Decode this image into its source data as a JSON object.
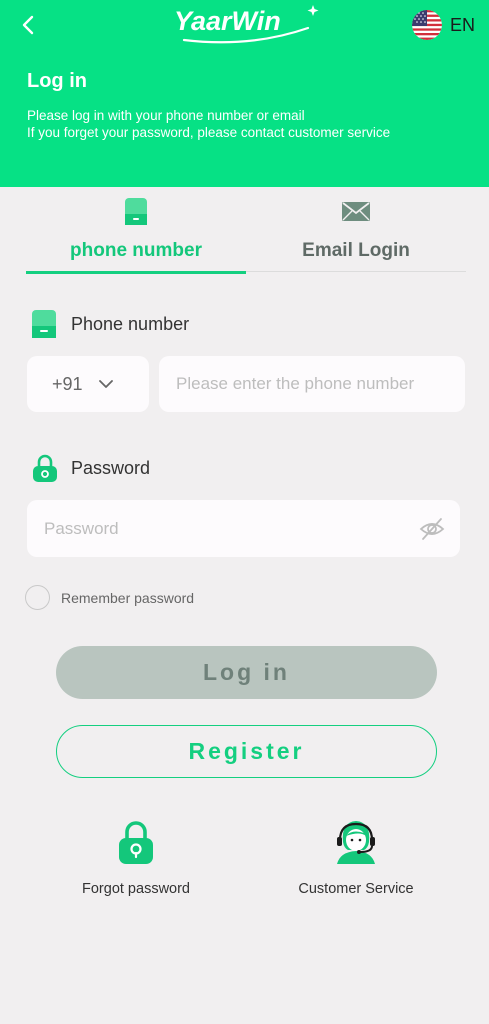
{
  "header": {
    "back_icon": "chevron-left-icon",
    "logo_text": "YaarWin",
    "language": "EN",
    "flag_icon": "us-flag-icon",
    "title": "Log in",
    "subtitle_line1": "Please log in with your phone number or email",
    "subtitle_line2": "If you forget your password, please contact customer service",
    "background_color": "#06e185"
  },
  "tabs": [
    {
      "label": "phone number",
      "icon": "phone-icon",
      "active": true
    },
    {
      "label": "Email Login",
      "icon": "envelope-icon",
      "active": false
    }
  ],
  "form": {
    "phone_label": "Phone number",
    "country_code": "+91",
    "phone_placeholder": "Please enter the phone number",
    "password_label": "Password",
    "password_placeholder": "Password",
    "remember_label": "Remember password",
    "remember_checked": false
  },
  "buttons": {
    "login": "Log in",
    "register": "Register"
  },
  "footer_links": {
    "forgot": {
      "label": "Forgot password",
      "icon": "lock-icon"
    },
    "service": {
      "label": "Customer Service",
      "icon": "headset-agent-icon"
    }
  },
  "colors": {
    "accent": "#14cf80",
    "header": "#06e185",
    "login_disabled_bg": "#b9c5bf",
    "background": "#f1eff0"
  }
}
